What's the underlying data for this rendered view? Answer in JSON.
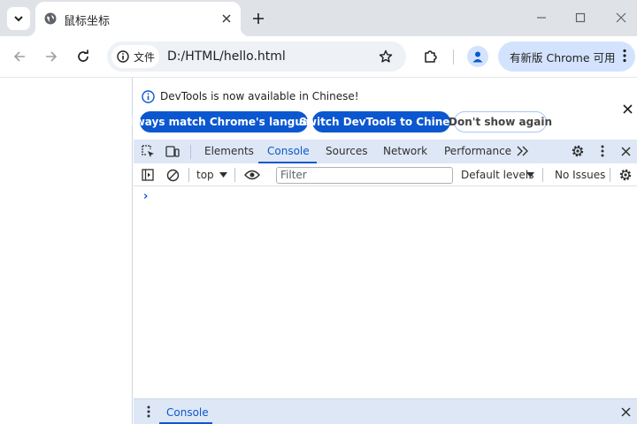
{
  "browser": {
    "tab_title": "鼠标坐标",
    "site_chip_label": "文件",
    "url": "D:/HTML/hello.html",
    "update_button_label": "有新版 Chrome 可用"
  },
  "devtools": {
    "infobar": {
      "message": "DevTools is now available in Chinese!",
      "match_language_label": "Always match Chrome's language",
      "switch_label": "Switch DevTools to Chinese",
      "dont_show_label": "Don't show again"
    },
    "tabs": [
      {
        "label": "Elements"
      },
      {
        "label": "Console",
        "active": true
      },
      {
        "label": "Sources"
      },
      {
        "label": "Network"
      },
      {
        "label": "Performance"
      }
    ],
    "console_toolbar": {
      "context": "top",
      "filter_placeholder": "Filter",
      "levels": "Default levels",
      "issues": "No Issues"
    },
    "prompt_glyph": "›",
    "drawer_tab": "Console"
  },
  "colors": {
    "accent": "#0b57d0",
    "tabstrip_bg": "#dfe3e8",
    "devtools_toolbar_bg": "#dee7f5",
    "update_button_bg": "#d3e3fd"
  }
}
